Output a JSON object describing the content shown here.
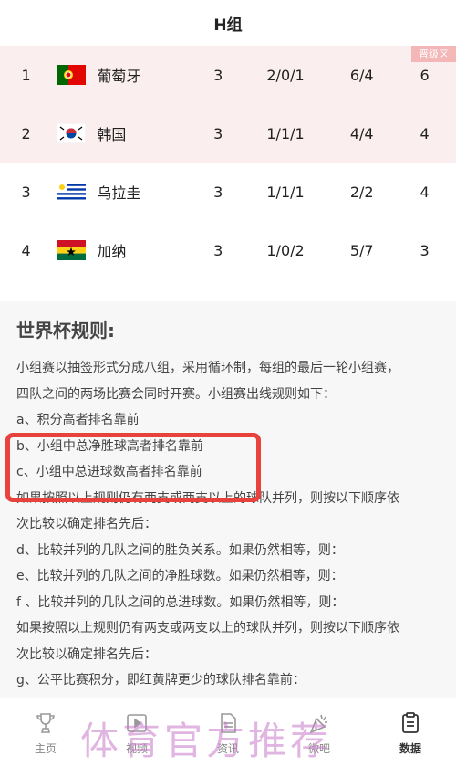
{
  "header": {
    "title": "H组"
  },
  "standings": {
    "badge": "晋级区",
    "rows": [
      {
        "rank": "1",
        "team": "葡萄牙",
        "flag": "portugal-flag-icon",
        "played": "3",
        "wdl": "2/0/1",
        "goals": "6/4",
        "points": "6"
      },
      {
        "rank": "2",
        "team": "韩国",
        "flag": "korea-flag-icon",
        "played": "3",
        "wdl": "1/1/1",
        "goals": "4/4",
        "points": "4"
      },
      {
        "rank": "3",
        "team": "乌拉圭",
        "flag": "uruguay-flag-icon",
        "played": "3",
        "wdl": "1/1/1",
        "goals": "2/2",
        "points": "4"
      },
      {
        "rank": "4",
        "team": "加纳",
        "flag": "ghana-flag-icon",
        "played": "3",
        "wdl": "1/0/2",
        "goals": "5/7",
        "points": "3"
      }
    ]
  },
  "rules": {
    "title": "世界杯规则:",
    "lines": [
      "小组赛以抽签形式分成八组，采用循环制，每组的最后一轮小组赛，",
      "四队之间的两场比赛会同时开赛。小组赛出线规则如下：",
      "a、积分高者排名靠前",
      "b、小组中总净胜球高者排名靠前",
      "c、小组中总进球数高者排名靠前",
      "如果按照以上规则仍有两支或两支以上的球队并列，则按以下顺序依",
      "次比较以确定排名先后：",
      "d、比较并列的几队之间的胜负关系。如果仍然相等，则：",
      "e、比较并列的几队之间的净胜球数。如果仍然相等，则：",
      "f 、比较并列的几队之间的总进球数。如果仍然相等，则：",
      "如果按照以上规则仍有两支或两支以上的球队并列，则按以下顺序依",
      "次比较以确定排名先后：",
      "g、公平比赛积分，即红黄牌更少的球队排名靠前："
    ]
  },
  "tabbar": {
    "items": [
      {
        "label": "主页",
        "icon": "trophy-icon"
      },
      {
        "label": "视频",
        "icon": "video-icon"
      },
      {
        "label": "资讯",
        "icon": "news-icon"
      },
      {
        "label": "微吧",
        "icon": "party-icon"
      },
      {
        "label": "数据",
        "icon": "data-icon"
      }
    ]
  },
  "watermark": "体育官方推荐",
  "colors": {
    "advance_bg": "#fbeeee",
    "badge_bg": "#f4b7b7",
    "highlight": "#e8423d",
    "watermark": "#c878c8"
  }
}
